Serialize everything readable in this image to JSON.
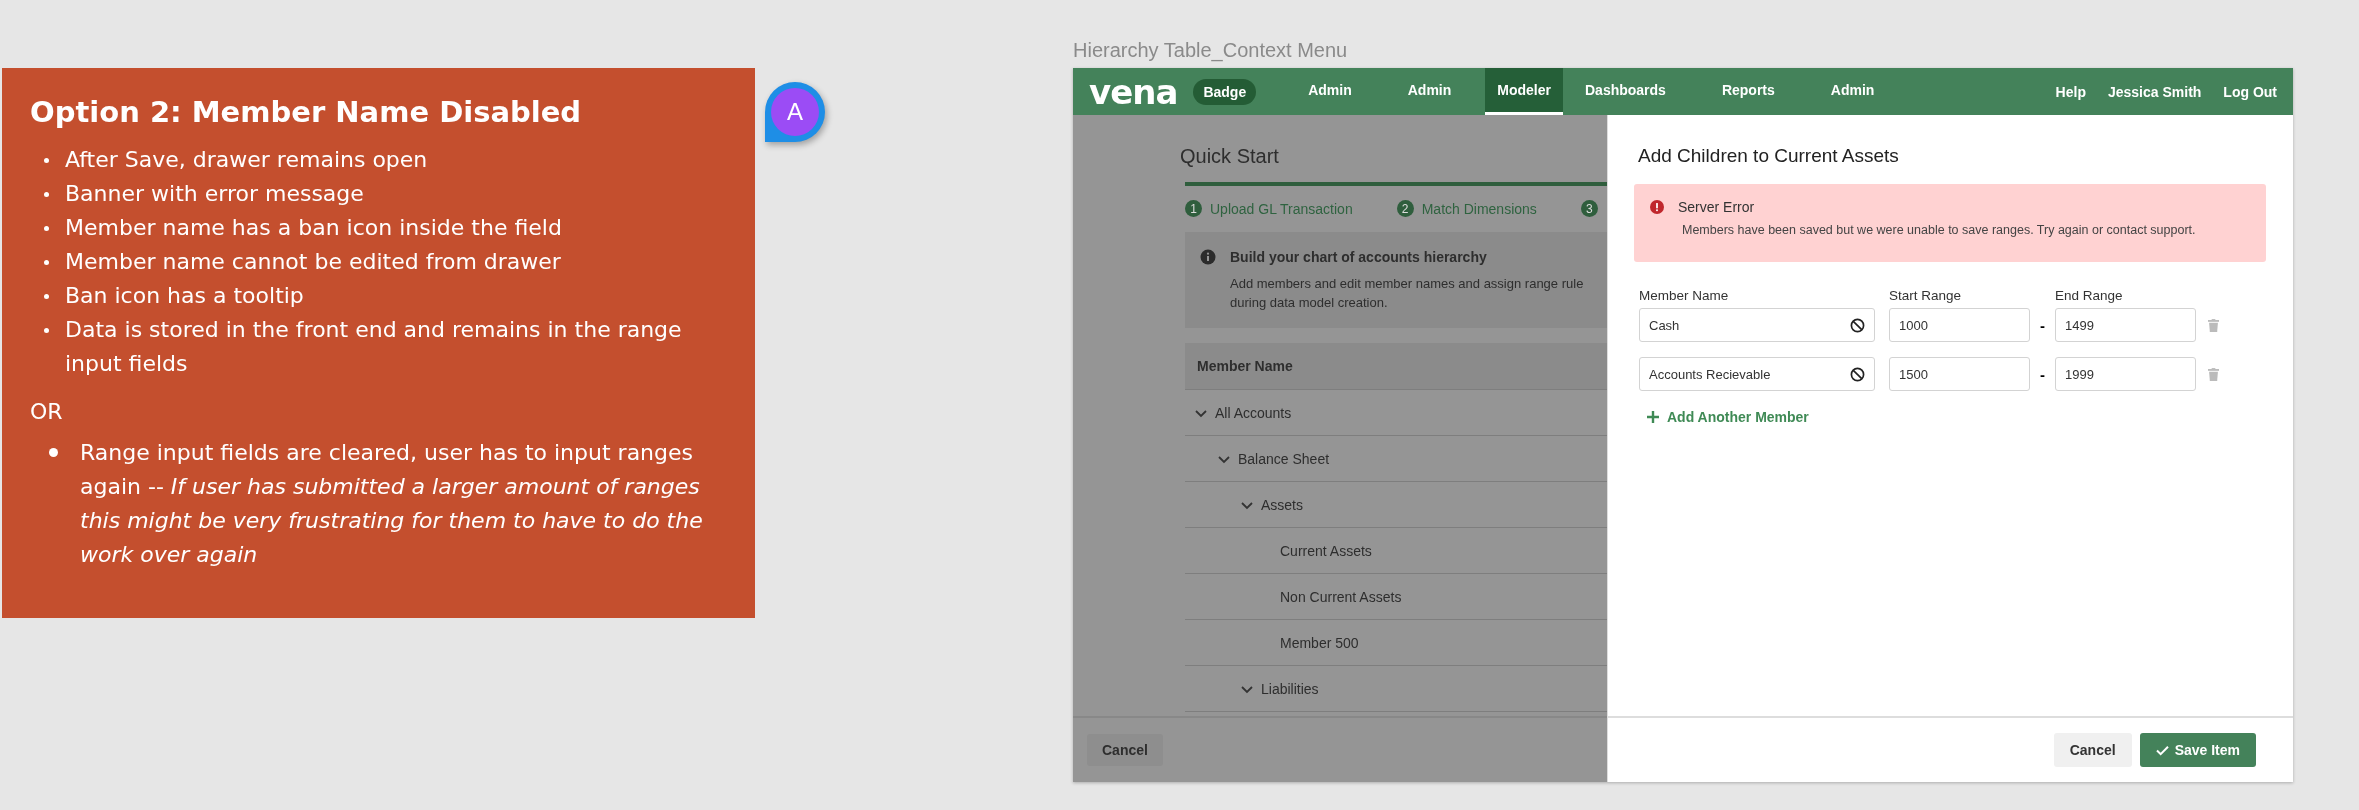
{
  "note_card": {
    "title": "Option 2: Member Name Disabled",
    "bullets": [
      "After Save, drawer remains open",
      "Banner with error message",
      "Member name has a ban icon inside the field",
      "Member name cannot be edited from drawer",
      "Ban icon has a tooltip",
      "Data is stored in the front end and remains in the range input fields"
    ],
    "separator": "OR",
    "alternative_bullets": [
      "Range input fields are cleared, user has to input ranges again -- *If user has submitted a larger amount of ranges this might be very frustrating for them to have to do the work over again*"
    ]
  },
  "comment_avatar": {
    "initial": "A"
  },
  "frame_title": "Hierarchy Table_Context Menu",
  "nav": {
    "logo": "vena",
    "badge": "Badge",
    "items": [
      {
        "label": "Admin",
        "selected": false
      },
      {
        "label": "Admin",
        "selected": false
      },
      {
        "label": "Modeler",
        "selected": true
      },
      {
        "label": "Dashboards",
        "selected": false
      },
      {
        "label": "Reports",
        "selected": false
      },
      {
        "label": "Admin",
        "selected": false
      }
    ],
    "right_items": [
      "Help",
      "Jessica Smith",
      "Log Out"
    ]
  },
  "quick_start": {
    "title": "Quick Start",
    "steps": [
      {
        "number": "1",
        "label": "Upload GL Transaction"
      },
      {
        "number": "2",
        "label": "Match Dimensions"
      },
      {
        "number": "3"
      }
    ],
    "info": {
      "title": "Build your chart of accounts hierarchy",
      "text": "Add members and edit member names and assign range rule",
      "text_2": "during data model creation."
    },
    "table": {
      "column": "Member Name",
      "tree": [
        {
          "label": "All Accounts",
          "expanded": true,
          "children": [
            {
              "label": "Balance Sheet",
              "expanded": true,
              "children": [
                {
                  "label": "Assets",
                  "expanded": true,
                  "children": [
                    {
                      "label": "Current Assets"
                    },
                    {
                      "label": "Non Current Assets"
                    },
                    {
                      "label": "Member 500"
                    }
                  ]
                },
                {
                  "label": "Liabilities",
                  "expanded": true
                }
              ]
            }
          ]
        }
      ]
    },
    "cancel": "Cancel"
  },
  "drawer": {
    "title": "Add Children to Current Assets",
    "error": {
      "title": "Server Error",
      "message": "Members have been saved but we were unable to save ranges. Try again or contact support."
    },
    "columns": [
      "Member Name",
      "Start Range",
      "End Range"
    ],
    "members": [
      {
        "name": "Cash",
        "disabled": true,
        "start": "1000",
        "end": "1499"
      },
      {
        "name": "Accounts Recievable",
        "disabled": true,
        "start": "1500",
        "end": "1999"
      }
    ],
    "range_separator": "-",
    "add_member": "Add Another Member",
    "cancel": "Cancel",
    "save": "Save Item"
  }
}
